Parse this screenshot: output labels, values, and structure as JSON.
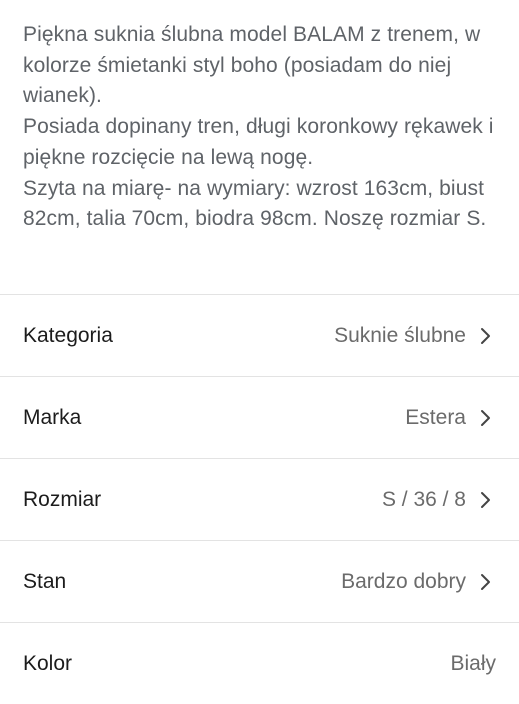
{
  "description": {
    "paragraph1": "Piękna suknia ślubna model BALAM z trenem, w kolorze śmietanki styl boho (posiadam do niej wianek).",
    "paragraph2": "Posiada dopinany tren, długi koronkowy rękawek i piękne rozcięcie na lewą nogę.",
    "paragraph3": "Szyta na miarę- na wymiary: wzrost 163cm, biust 82cm, talia 70cm, biodra 98cm. Noszę rozmiar S."
  },
  "attributes": [
    {
      "label": "Kategoria",
      "value": "Suknie ślubne",
      "icon": "chevron-right-icon"
    },
    {
      "label": "Marka",
      "value": "Estera",
      "icon": "chevron-right-icon"
    },
    {
      "label": "Rozmiar",
      "value": "S / 36 / 8",
      "icon": "chevron-right-icon"
    },
    {
      "label": "Stan",
      "value": "Bardzo dobry",
      "icon": "chevron-right-icon"
    },
    {
      "label": "Kolor",
      "value": "Biały"
    }
  ],
  "colors": {
    "description_text": "#5f6368",
    "label_text": "#1c1c1c",
    "value_text": "#6b6b6b",
    "divider": "#e3e3e3"
  }
}
